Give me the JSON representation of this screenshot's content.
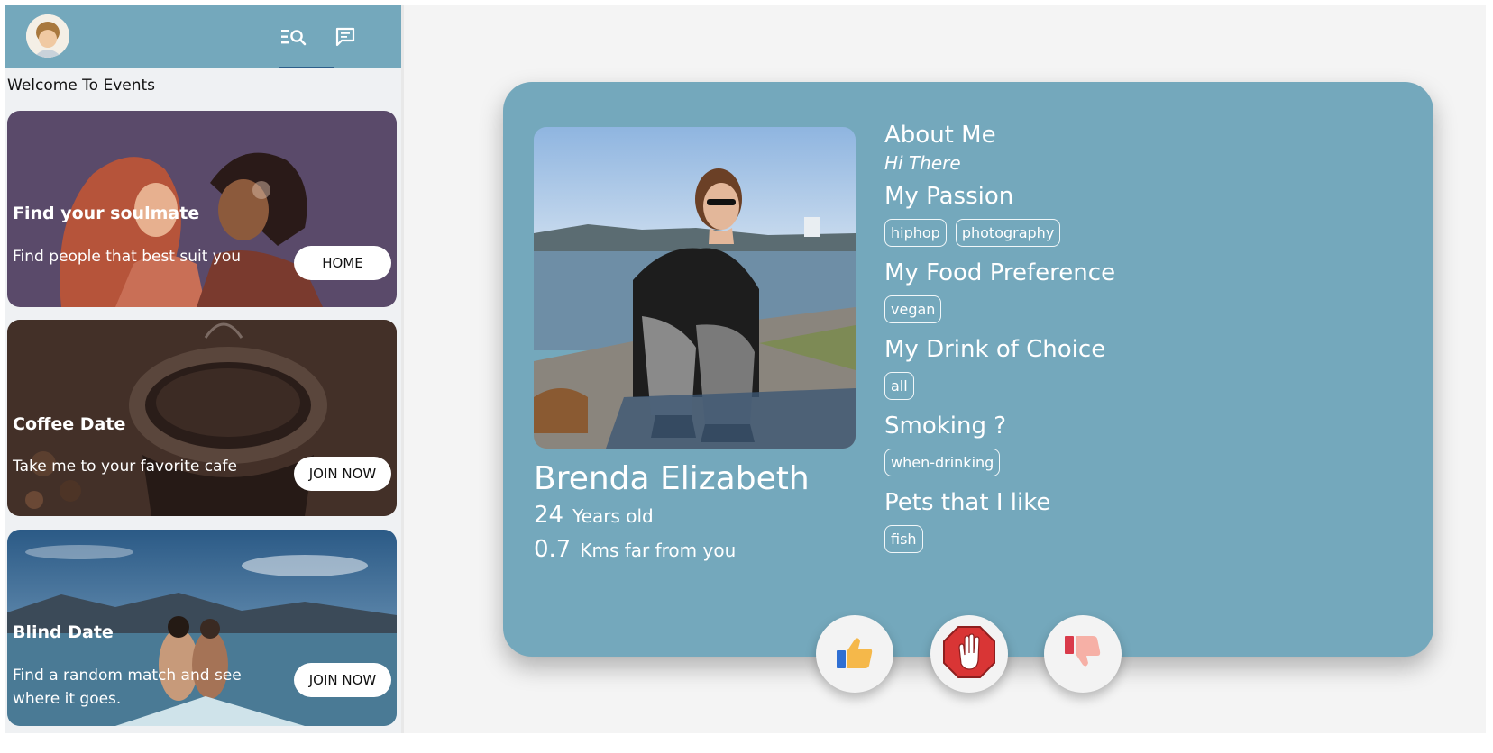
{
  "sidebar": {
    "welcome": "Welcome To Events",
    "events": [
      {
        "title": "Find your soulmate",
        "subtitle": "Find people that best suit you",
        "button": "HOME"
      },
      {
        "title": "Coffee Date",
        "subtitle": "Take me to your favorite cafe",
        "button": "JOIN NOW"
      },
      {
        "title": "Blind Date",
        "subtitle": "Find a random match and see where it goes.",
        "button": "JOIN NOW"
      }
    ]
  },
  "profile": {
    "name": "Brenda Elizabeth",
    "age": "24",
    "age_label": "Years old",
    "distance": "0.7",
    "distance_label": "Kms far from you",
    "about_heading": "About Me",
    "about_text": "Hi There",
    "passion_heading": "My Passion",
    "passions": [
      "hiphop",
      "photography"
    ],
    "food_heading": "My Food Preference",
    "foods": [
      "vegan"
    ],
    "drink_heading": "My Drink of Choice",
    "drinks": [
      "all"
    ],
    "smoking_heading": "Smoking ?",
    "smoking": [
      "when-drinking"
    ],
    "pets_heading": "Pets that I like",
    "pets": [
      "fish"
    ]
  },
  "colors": {
    "accent": "#74a8bc",
    "tab_underline": "#2d5f8a",
    "stop_red": "#d93535"
  },
  "icons": {
    "tab1": "search-list-icon",
    "tab2": "chat-icon",
    "like": "thumbs-up-icon",
    "stop": "stop-hand-icon",
    "dislike": "thumbs-down-icon"
  }
}
